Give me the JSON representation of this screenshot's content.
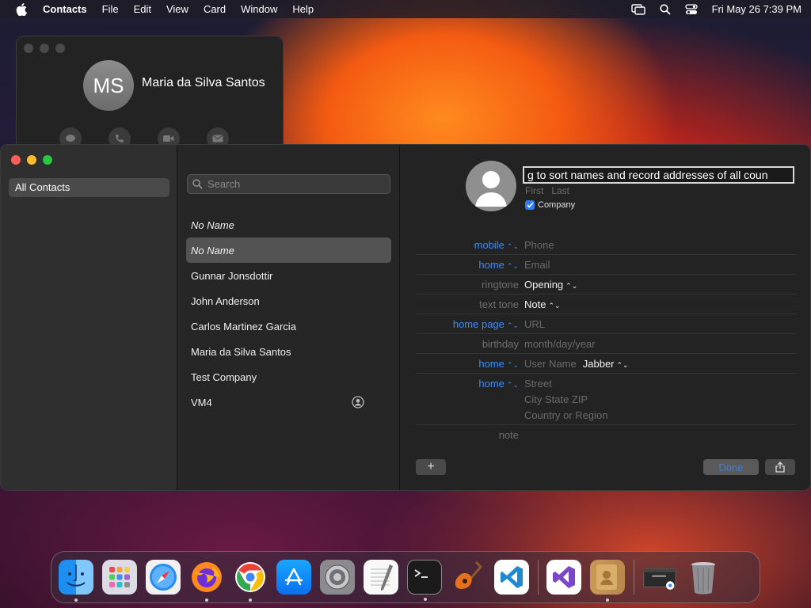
{
  "menubar": {
    "app_name": "Contacts",
    "menus": [
      "File",
      "Edit",
      "View",
      "Card",
      "Window",
      "Help"
    ],
    "clock": "Fri May 26  7:39 PM"
  },
  "mini_card": {
    "initials": "MS",
    "name": "Maria da Silva Santos"
  },
  "sidebar": {
    "items": [
      {
        "label": "All Contacts"
      }
    ]
  },
  "search": {
    "placeholder": "Search"
  },
  "contacts": [
    {
      "name": "No Name"
    },
    {
      "name": "No Name"
    },
    {
      "name": "Gunnar Jonsdottir"
    },
    {
      "name": "John Anderson"
    },
    {
      "name": "Carlos Martinez Garcia"
    },
    {
      "name": "Maria da Silva Santos"
    },
    {
      "name": "Test Company"
    },
    {
      "name": "VM4"
    }
  ],
  "detail": {
    "name_value": "g to sort names and record addresses of all coun",
    "first_placeholder": "First",
    "last_placeholder": "Last",
    "company_label": "Company",
    "company_checked": true,
    "fields": [
      {
        "label": "mobile",
        "value": "Phone"
      },
      {
        "label": "home",
        "value": "Email"
      },
      {
        "label": "ringtone",
        "value": "Opening"
      },
      {
        "label": "text tone",
        "value": "Note"
      },
      {
        "label": "home page",
        "value": "URL"
      },
      {
        "label": "birthday",
        "value": "month/day/year"
      },
      {
        "label": "home",
        "value": "User Name",
        "extra": "Jabber"
      },
      {
        "label": "home",
        "value": "Street",
        "line2": "City  State  ZIP",
        "line3": "Country or Region"
      },
      {
        "label": "note",
        "value": ""
      }
    ],
    "plus_label": "+",
    "done_label": "Done"
  },
  "dock": {
    "apps": [
      "finder",
      "launchpad",
      "safari",
      "firefox",
      "chrome",
      "app-store",
      "system-preferences",
      "textedit",
      "terminal",
      "garageband",
      "vscode",
      "visual-studio",
      "contacts",
      "chrome-window",
      "trash"
    ]
  },
  "colors": {
    "accent_blue": "#3b8cf5",
    "window_bg": "#232323"
  }
}
